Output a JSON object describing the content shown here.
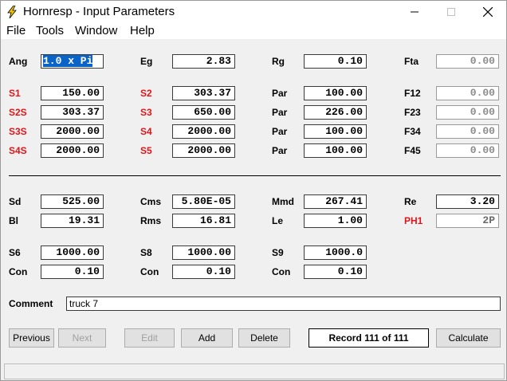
{
  "window": {
    "title": "Hornresp - Input Parameters"
  },
  "menu": [
    "File",
    "Tools",
    "Window",
    "Help"
  ],
  "params": {
    "ang": {
      "label": "Ang",
      "value": "1.0 x Pi"
    },
    "eg": {
      "label": "Eg",
      "value": "2.83"
    },
    "rg": {
      "label": "Rg",
      "value": "0.10"
    },
    "fta": {
      "label": "Fta",
      "value": "0.00"
    },
    "s1": {
      "label": "S1",
      "value": "150.00"
    },
    "s2": {
      "label": "S2",
      "value": "303.37"
    },
    "par1": {
      "label": "Par",
      "value": "100.00"
    },
    "f12": {
      "label": "F12",
      "value": "0.00"
    },
    "s2s": {
      "label": "S2S",
      "value": "303.37"
    },
    "s3": {
      "label": "S3",
      "value": "650.00"
    },
    "par2": {
      "label": "Par",
      "value": "226.00"
    },
    "f23": {
      "label": "F23",
      "value": "0.00"
    },
    "s3s": {
      "label": "S3S",
      "value": "2000.00"
    },
    "s4": {
      "label": "S4",
      "value": "2000.00"
    },
    "par3": {
      "label": "Par",
      "value": "100.00"
    },
    "f34": {
      "label": "F34",
      "value": "0.00"
    },
    "s4s": {
      "label": "S4S",
      "value": "2000.00"
    },
    "s5": {
      "label": "S5",
      "value": "2000.00"
    },
    "par4": {
      "label": "Par",
      "value": "100.00"
    },
    "f45": {
      "label": "F45",
      "value": "0.00"
    },
    "sd": {
      "label": "Sd",
      "value": "525.00"
    },
    "cms": {
      "label": "Cms",
      "value": "5.80E-05"
    },
    "mmd": {
      "label": "Mmd",
      "value": "267.41"
    },
    "re": {
      "label": "Re",
      "value": "3.20"
    },
    "bl": {
      "label": "Bl",
      "value": "19.31"
    },
    "rms": {
      "label": "Rms",
      "value": "16.81"
    },
    "le": {
      "label": "Le",
      "value": "1.00"
    },
    "ph1": {
      "label": "PH1",
      "value": "2P"
    },
    "s6": {
      "label": "S6",
      "value": "1000.00"
    },
    "s8": {
      "label": "S8",
      "value": "1000.00"
    },
    "s9": {
      "label": "S9",
      "value": "1000.0"
    },
    "con1": {
      "label": "Con",
      "value": "0.10"
    },
    "con2": {
      "label": "Con",
      "value": "0.10"
    },
    "con3": {
      "label": "Con",
      "value": "0.10"
    }
  },
  "comment": {
    "label": "Comment",
    "value": "truck 7"
  },
  "buttons": {
    "previous": "Previous",
    "next": "Next",
    "edit": "Edit",
    "add": "Add",
    "delete": "Delete",
    "calculate": "Calculate"
  },
  "record": "Record 111 of 111",
  "colors": {
    "accent_red": "#e0151b",
    "selection": "#0a64c8"
  }
}
